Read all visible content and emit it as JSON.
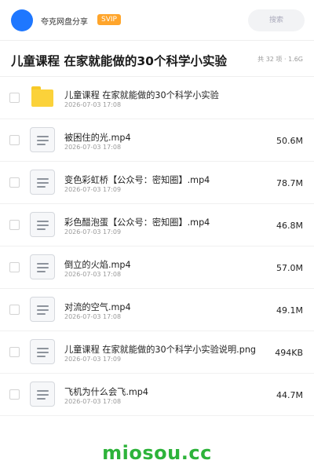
{
  "header": {
    "username": "夸克网盘分享",
    "badge": "SVIP",
    "search_placeholder": "搜索"
  },
  "title": {
    "text": "儿童课程 在家就能做的30个科学小实验",
    "meta": "共 32 项 · 1.6G"
  },
  "files": [
    {
      "type": "folder",
      "name": "儿童课程 在家就能做的30个科学小实验",
      "date": "2026-07-03 17:08",
      "size": ""
    },
    {
      "type": "doc",
      "name": "被困住的光.mp4",
      "date": "2026-07-03 17:08",
      "size": "50.6M"
    },
    {
      "type": "doc",
      "name": "变色彩虹桥【公众号：密知圈】.mp4",
      "date": "2026-07-03 17:09",
      "size": "78.7M"
    },
    {
      "type": "doc",
      "name": "彩色醋泡蛋【公众号：密知圈】.mp4",
      "date": "2026-07-03 17:09",
      "size": "46.8M"
    },
    {
      "type": "doc",
      "name": "倒立的火焰.mp4",
      "date": "2026-07-03 17:08",
      "size": "57.0M"
    },
    {
      "type": "doc",
      "name": "对流的空气.mp4",
      "date": "2026-07-03 17:08",
      "size": "49.1M"
    },
    {
      "type": "doc",
      "name": "儿童课程 在家就能做的30个科学小实验说明.png",
      "date": "2026-07-03 17:09",
      "size": "494KB"
    },
    {
      "type": "doc",
      "name": "飞机为什么会飞.mp4",
      "date": "2026-07-03 17:08",
      "size": "44.7M"
    }
  ],
  "watermark": "miosou.cc",
  "colors": {
    "accent": "#1e77ff",
    "badge": "#ffa52b",
    "folder": "#fbd23a",
    "watermark": "#2db33a"
  }
}
